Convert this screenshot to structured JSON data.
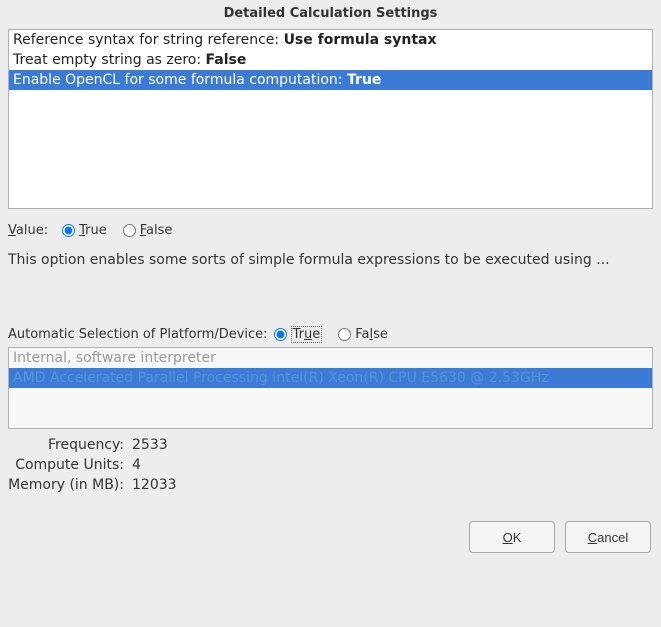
{
  "title": "Detailed Calculation Settings",
  "settings_list": [
    {
      "label": "Reference syntax for string reference:",
      "value": "Use formula syntax",
      "selected": false
    },
    {
      "label": "Treat empty string as zero:",
      "value": "False",
      "selected": false
    },
    {
      "label": "Enable OpenCL for some formula computation:",
      "value": "True",
      "selected": true
    }
  ],
  "value_section": {
    "label_before": "V",
    "label_underlined": "alue:",
    "true_underlined": "T",
    "true_rest": "rue",
    "false_underlined": "F",
    "false_rest": "alse",
    "selected": "true"
  },
  "description": "This option enables some sorts of simple formula expressions to be executed using ...",
  "platform_section": {
    "label": "Automatic Selection of Platform/Device:",
    "true_underlined": "u",
    "true_before": "Tr",
    "true_after": "e",
    "false_before": "Fa",
    "false_underlined": "l",
    "false_after": "se",
    "selected": "true"
  },
  "devices": [
    {
      "text": "Internal, software interpreter",
      "selected": false
    },
    {
      "text": "AMD Accelerated Parallel Processing Intel(R) Xeon(R) CPU         E5630  @ 2.53GHz",
      "selected": true
    }
  ],
  "specs": {
    "frequency_label": "Frequency:",
    "frequency_value": "2533",
    "compute_label": "Compute Units:",
    "compute_value": "4",
    "memory_label": "Memory (in MB):",
    "memory_value": "12033"
  },
  "buttons": {
    "ok_underlined": "O",
    "ok_rest": "K",
    "cancel_underlined": "C",
    "cancel_rest": "ancel"
  }
}
